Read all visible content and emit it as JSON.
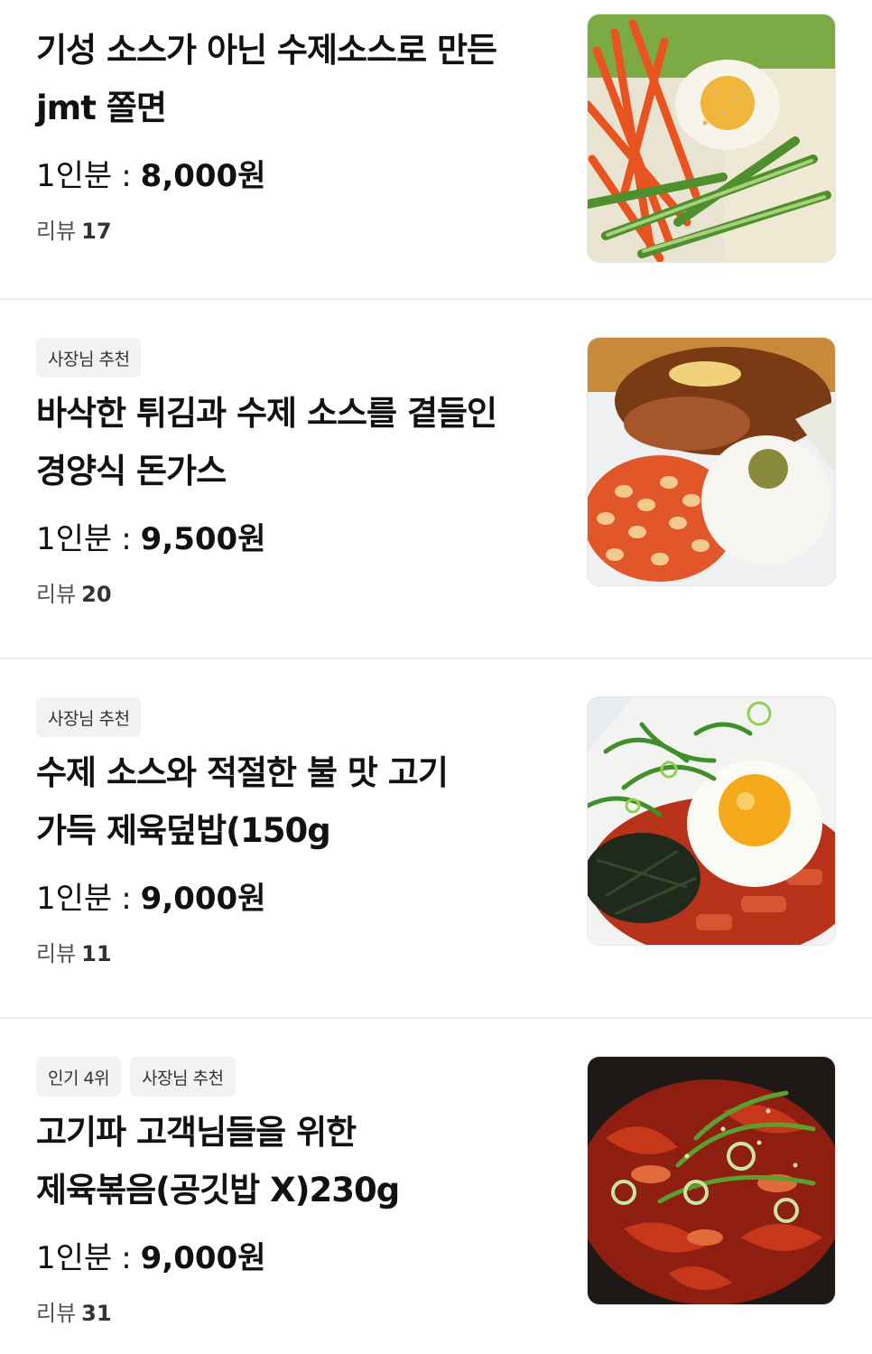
{
  "items": [
    {
      "badges": [],
      "title_line1": "기성 소스가 아닌 수제소스로 만든",
      "title_line2": "jmt 쫄면",
      "serving": "1인분",
      "price": "8,000원",
      "review_label": "리뷰",
      "review_count": "17",
      "image_icon": "jjolmyeon-photo"
    },
    {
      "badges": [
        "사장님 추천"
      ],
      "title_line1": "바삭한 튀김과 수제 소스를 곁들인",
      "title_line2": "경양식 돈가스",
      "serving": "1인분",
      "price": "9,500원",
      "review_label": "리뷰",
      "review_count": "20",
      "image_icon": "donkatsu-photo"
    },
    {
      "badges": [
        "사장님 추천"
      ],
      "title_line1": "수제 소스와 적절한 불 맛 고기",
      "title_line2": "가득 제육덮밥(150g",
      "serving": "1인분",
      "price": "9,000원",
      "review_label": "리뷰",
      "review_count": "11",
      "image_icon": "jeyuk-rice-bowl-photo"
    },
    {
      "badges": [
        "인기 4위",
        "사장님 추천"
      ],
      "title_line1": "고기파 고객님들을 위한",
      "title_line2": "제육볶음(공깃밥 X)230g",
      "serving": "1인분",
      "price": "9,000원",
      "review_label": "리뷰",
      "review_count": "31",
      "image_icon": "jeyuk-bokkeum-photo"
    }
  ],
  "colors": {
    "badge_bg": "#f1f2f4",
    "divider": "#eeeeee",
    "text": "#111111"
  }
}
